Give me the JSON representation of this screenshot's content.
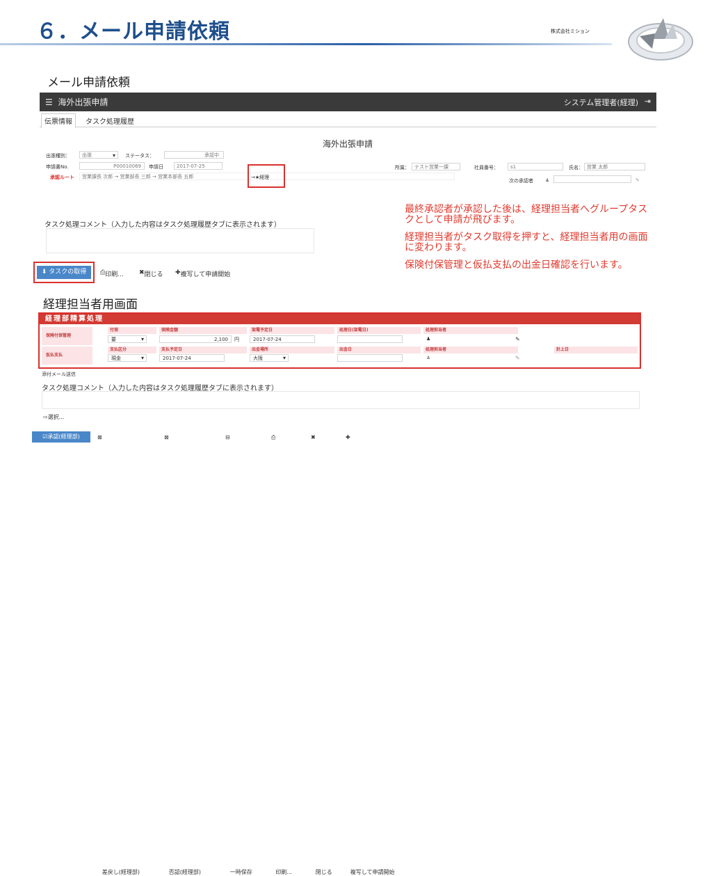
{
  "slide": {
    "title": "６．メール申請依頼",
    "company": "株式会社ミション"
  },
  "section1": "メール申請依頼",
  "app": {
    "title": "海外出張申請",
    "user": "システム管理者(経理)",
    "logout_icon": "logout-icon"
  },
  "tabs": [
    "伝票情報",
    "タスク処理履歴"
  ],
  "form": {
    "title": "海外出張申請",
    "trip_type_label": "出張種別：",
    "trip_type_value": "出張",
    "status_label": "ステータス：",
    "status_value": "承認中",
    "app_no_label": "申請書No.",
    "app_no_value": "P00010069",
    "app_date_label": "申請日",
    "app_date_value": "2017-07-25",
    "route_label": "承認ルート",
    "route_value": "営業課長 次郎 → 営業部長 三郎 → 営業本部長 五郎",
    "route_next": "→★経理",
    "dept_label": "所属：",
    "dept_value": "テスト営業一課",
    "emp_no_label": "社員番号：",
    "emp_no_value": "s1",
    "name_label": "氏名：",
    "name_value": "営業 太郎",
    "next_approver_label": "次の承認者"
  },
  "note": {
    "p1": "最終承認者が承認した後は、経理担当者へグループタスクとして申請が飛びます。",
    "p2": "経理担当者がタスク取得を押すと、経理担当者用の画面に変わります。",
    "p3": "保険付保管理と仮払支払の出金日確認を行います。"
  },
  "comment_label": "タスク処理コメント（入力した内容はタスク処理履歴タブに表示されます）",
  "buttons1": {
    "take_task": "タスクの取得",
    "print": "印刷...",
    "close": "閉じる",
    "copy": "複写して申請開始"
  },
  "section2": "経理担当者用画面",
  "panel": {
    "title": "経理部精算処理",
    "row1": {
      "label": "保険付保管理",
      "h_status": "付保",
      "h_amount": "保険金額",
      "h_plan": "架電予定日",
      "h_done": "処理日(架電日)",
      "h_handler": "処理担当者",
      "status": "要",
      "amount": "2,100",
      "unit": "円",
      "plan": "2017-07-24"
    },
    "row2": {
      "label": "仮払支払",
      "h_kind": "支払区分",
      "h_plan": "支払予定日",
      "h_place": "出金場所",
      "h_out": "出金日",
      "h_handler": "処理担当者",
      "h_post": "計上日",
      "kind": "現金",
      "plan": "2017-07-24",
      "place": "大阪"
    }
  },
  "attach_label": "添付メール送信",
  "comment_label2": "タスク処理コメント（入力した内容はタスク処理履歴タブに表示されます）",
  "select_label": "選択...",
  "buttons2": {
    "approve": "承認(経理部)",
    "return": "差戻し(経理部)",
    "confirm": "否認(経理部)",
    "save": "一時保存",
    "print": "印刷...",
    "close": "閉じる",
    "copy": "複写して申請開始"
  }
}
